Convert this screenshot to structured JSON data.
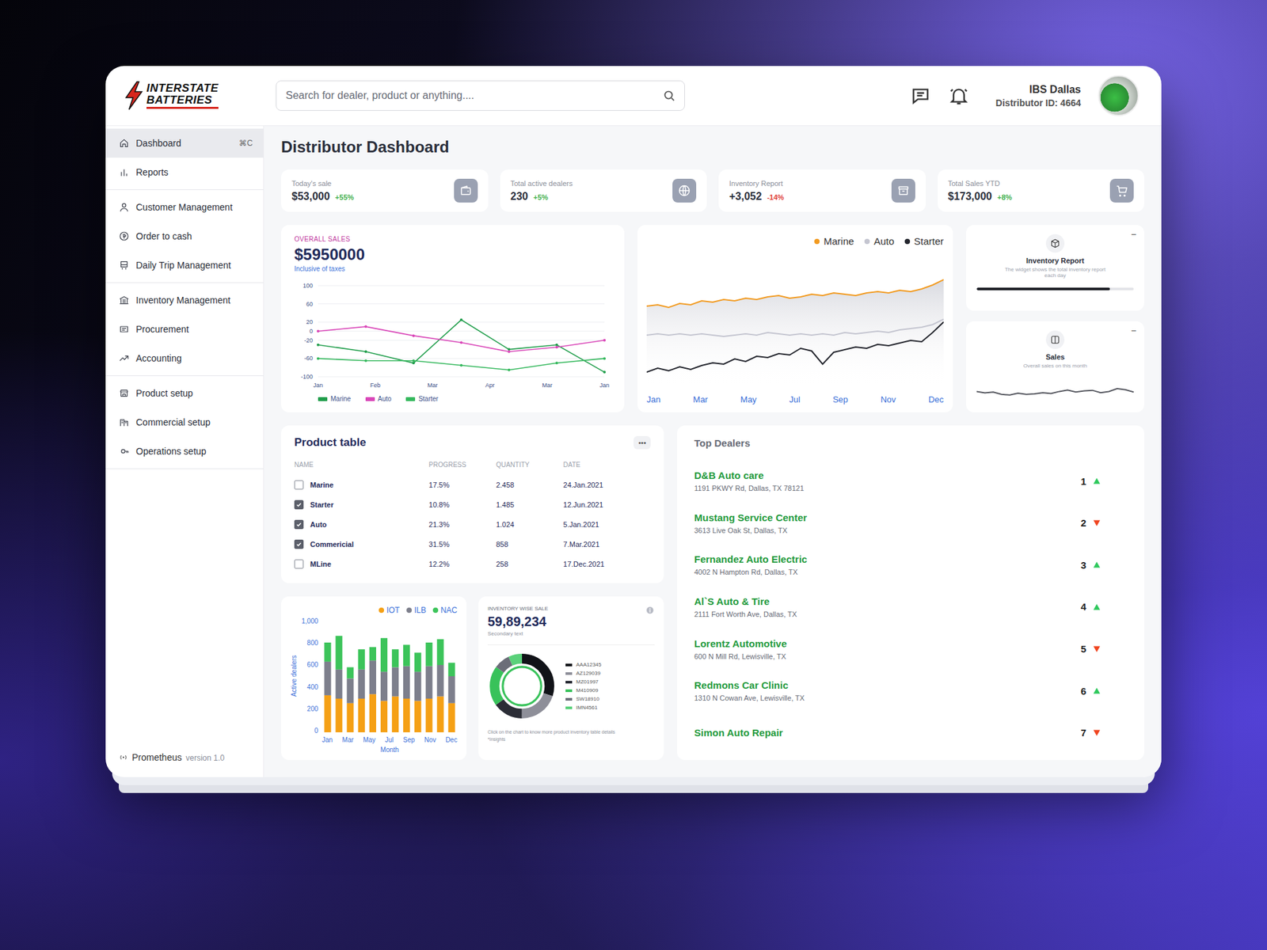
{
  "brand": {
    "logo_lines": [
      "INTERSTATE",
      "BATTERIES"
    ]
  },
  "search": {
    "placeholder": "Search for dealer, product or anything...."
  },
  "user": {
    "name": "IBS Dallas",
    "id_line": "Distributor ID: 4664"
  },
  "sidebar": {
    "groups": [
      [
        {
          "label": "Dashboard",
          "selected": true,
          "shortcut": "⌘C"
        },
        {
          "label": "Reports",
          "selected": false
        }
      ],
      [
        {
          "label": "Customer Management",
          "selected": false
        },
        {
          "label": "Order to cash",
          "selected": false
        },
        {
          "label": "Daily Trip Management",
          "selected": false
        }
      ],
      [
        {
          "label": "Inventory Management",
          "selected": false
        },
        {
          "label": "Procurement",
          "selected": false
        },
        {
          "label": "Accounting",
          "selected": false
        }
      ],
      [
        {
          "label": "Product setup",
          "selected": false
        },
        {
          "label": "Commercial setup",
          "selected": false
        },
        {
          "label": "Operations setup",
          "selected": false
        }
      ]
    ],
    "footer": {
      "name": "Prometheus",
      "version": "version 1.0"
    }
  },
  "page_title": "Distributor Dashboard",
  "stats": [
    {
      "label": "Today's sale",
      "value": "$53,000",
      "change": "+55%",
      "trend": "up"
    },
    {
      "label": "Total active dealers",
      "value": "230",
      "change": "+5%",
      "trend": "up"
    },
    {
      "label": "Inventory Report",
      "value": "+3,052",
      "change": "-14%",
      "trend": "down"
    },
    {
      "label": "Total Sales YTD",
      "value": "$173,000",
      "change": "+8%",
      "trend": "up"
    }
  ],
  "overall_sales": {
    "eyebrow": "OVERALL SALES",
    "value": "$5950000",
    "note": "Inclusive of taxes",
    "y_ticks": [
      "100",
      "60",
      "20",
      "0",
      "-20",
      "-60",
      "-100"
    ],
    "x_ticks": [
      "Jan",
      "Feb",
      "Mar",
      "Apr",
      "Mar",
      "Jan"
    ],
    "series": [
      {
        "name": "Marine",
        "color": "#1f9d4a",
        "values": [
          -30,
          -45,
          -70,
          25,
          -40,
          -30,
          -90
        ]
      },
      {
        "name": "Auto",
        "color": "#d946b8",
        "values": [
          0,
          10,
          -10,
          -25,
          -45,
          -35,
          -20
        ]
      },
      {
        "name": "Starter",
        "color": "#34b85c",
        "values": [
          -60,
          -65,
          -65,
          -75,
          -85,
          -70,
          -60
        ]
      }
    ]
  },
  "trend_chart": {
    "x_ticks": [
      "Jan",
      "Mar",
      "May",
      "Jul",
      "Sep",
      "Nov",
      "Dec"
    ],
    "series": [
      {
        "name": "Marine",
        "color": "#f29a1f",
        "values": [
          62,
          63,
          61,
          64,
          63,
          66,
          65,
          67,
          66,
          68,
          67,
          69,
          70,
          68,
          69,
          71,
          70,
          72,
          71,
          70,
          72,
          73,
          72,
          74,
          73,
          75,
          78,
          82
        ]
      },
      {
        "name": "Auto",
        "color": "#c4c5d0",
        "values": [
          40,
          41,
          40,
          41,
          40,
          41,
          40,
          39,
          40,
          41,
          40,
          42,
          41,
          40,
          41,
          40,
          41,
          40,
          42,
          41,
          42,
          43,
          42,
          44,
          45,
          46,
          48,
          52
        ]
      },
      {
        "name": "Starter",
        "color": "#22242c",
        "values": [
          12,
          15,
          13,
          16,
          14,
          17,
          19,
          18,
          22,
          20,
          24,
          23,
          26,
          25,
          30,
          28,
          18,
          27,
          29,
          31,
          30,
          33,
          32,
          34,
          36,
          35,
          42,
          50
        ]
      }
    ]
  },
  "mini_cards": [
    {
      "title": "Inventory Report",
      "description": "The widget shows the total inventory report each day",
      "action": "−",
      "kind": "progress",
      "level": 0.85
    },
    {
      "title": "Sales",
      "description": "Overall sales on this month",
      "action": "−",
      "kind": "sparkline",
      "values": [
        40,
        35,
        38,
        30,
        28,
        34,
        30,
        32,
        36,
        33,
        40,
        45,
        38,
        42,
        44,
        36,
        40,
        50,
        46,
        38
      ]
    }
  ],
  "product_table": {
    "title": "Product table",
    "menu": "•••",
    "columns": [
      "NAME",
      "PROGRESS",
      "QUANTITY",
      "DATE"
    ],
    "rows": [
      {
        "name": "Marine",
        "checked": false,
        "progress": "17.5%",
        "quantity": "2.458",
        "date": "24.Jan.2021"
      },
      {
        "name": "Starter",
        "checked": true,
        "progress": "10.8%",
        "quantity": "1.485",
        "date": "12.Jun.2021"
      },
      {
        "name": "Auto",
        "checked": true,
        "progress": "21.3%",
        "quantity": "1.024",
        "date": "5.Jan.2021"
      },
      {
        "name": "Commericial",
        "checked": true,
        "progress": "31.5%",
        "quantity": "858",
        "date": "7.Mar.2021"
      },
      {
        "name": "MLine",
        "checked": false,
        "progress": "12.2%",
        "quantity": "258",
        "date": "17.Dec.2021"
      }
    ]
  },
  "bar_chart": {
    "y_label": "Active dealers",
    "x_label": "Month",
    "y_ticks": [
      "1,000",
      "800",
      "600",
      "400",
      "200",
      "0"
    ],
    "x_ticks": [
      "Jan",
      "Mar",
      "May",
      "Jul",
      "Sep",
      "Nov",
      "Dec"
    ],
    "series": [
      {
        "name": "IOT",
        "color": "#f5a015",
        "values": [
          330,
          300,
          260,
          300,
          340,
          280,
          320,
          300,
          280,
          300,
          320,
          260
        ]
      },
      {
        "name": "ILB",
        "color": "#7d7f8c",
        "values": [
          300,
          260,
          220,
          260,
          300,
          260,
          260,
          290,
          260,
          290,
          280,
          240
        ]
      },
      {
        "name": "NAC",
        "color": "#3cc45a",
        "values": [
          170,
          300,
          100,
          180,
          120,
          300,
          160,
          190,
          170,
          210,
          230,
          120
        ]
      }
    ]
  },
  "inventory_sale": {
    "eyebrow": "INVENTORY WISE SALE",
    "value": "59,89,234",
    "note": "Secondary text",
    "segments": [
      {
        "label": "AAA12345",
        "value": 30,
        "color": "#111318"
      },
      {
        "label": "AZ129039",
        "value": 20,
        "color": "#8e8f99"
      },
      {
        "label": "MZ01997",
        "value": 15,
        "color": "#2b2d36"
      },
      {
        "label": "M410909",
        "value": 20,
        "color": "#38c25a"
      },
      {
        "label": "SW18910",
        "value": 8,
        "color": "#6b6d78"
      },
      {
        "label": "IMN4561",
        "value": 7,
        "color": "#5ad17a"
      }
    ],
    "footnote": "Click on the chart to know more product inventory table details",
    "link": "*Insights"
  },
  "top_dealers": {
    "title": "Top Dealers",
    "items": [
      {
        "name": "D&B Auto care",
        "address": "1191 PKWY Rd, Dallas, TX 78121",
        "rank": "1",
        "trend": "up"
      },
      {
        "name": "Mustang Service Center",
        "address": "3613 Live Oak St, Dallas, TX",
        "rank": "2",
        "trend": "down"
      },
      {
        "name": "Fernandez Auto Electric",
        "address": "4002 N Hampton Rd, Dallas, TX",
        "rank": "3",
        "trend": "up"
      },
      {
        "name": "Al`S Auto & Tire",
        "address": "2111 Fort Worth Ave, Dallas, TX",
        "rank": "4",
        "trend": "up"
      },
      {
        "name": "Lorentz Automotive",
        "address": "600 N Mill Rd, Lewisville, TX",
        "rank": "5",
        "trend": "down"
      },
      {
        "name": "Redmons Car Clinic",
        "address": "1310 N Cowan Ave, Lewisville, TX",
        "rank": "6",
        "trend": "up"
      },
      {
        "name": "Simon Auto Repair",
        "rank": "7",
        "trend": "down"
      }
    ]
  }
}
